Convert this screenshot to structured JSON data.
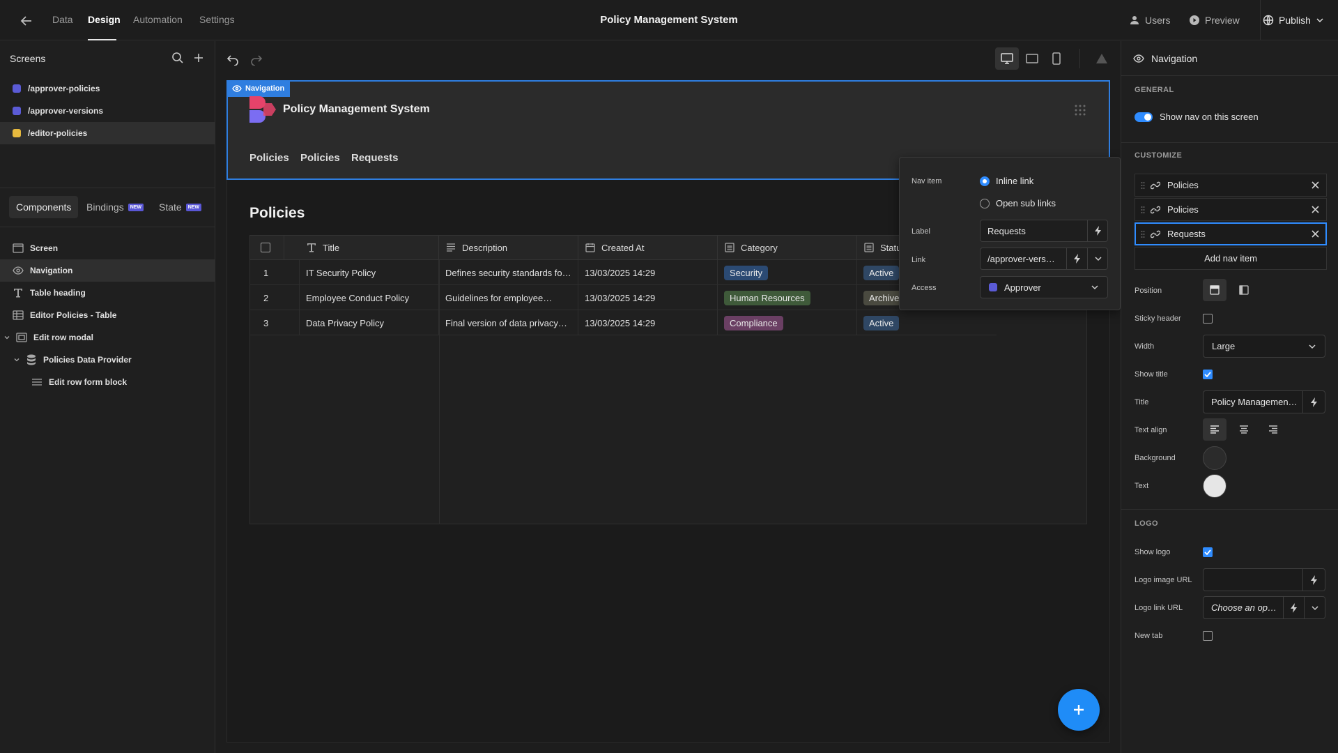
{
  "topbar": {
    "tabs": [
      {
        "label": "Data"
      },
      {
        "label": "Design"
      },
      {
        "label": "Automation"
      },
      {
        "label": "Settings"
      }
    ],
    "title": "Policy Management System",
    "users_label": "Users",
    "preview_label": "Preview",
    "publish_label": "Publish"
  },
  "left_panel": {
    "screens_title": "Screens",
    "screens": [
      {
        "route": "/approver-policies",
        "color": "#5b5bd6"
      },
      {
        "route": "/approver-versions",
        "color": "#5b5bd6"
      },
      {
        "route": "/editor-policies",
        "color": "#e6b93e"
      }
    ],
    "subtabs": [
      {
        "label": "Components",
        "badge": ""
      },
      {
        "label": "Bindings",
        "badge": "NEW"
      },
      {
        "label": "State",
        "badge": "NEW"
      }
    ],
    "components": [
      {
        "label": "Screen",
        "icon": "screen-icon"
      },
      {
        "label": "Navigation",
        "icon": "eye-icon"
      },
      {
        "label": "Table heading",
        "icon": "text-icon"
      },
      {
        "label": "Editor Policies - Table",
        "icon": "table-icon"
      },
      {
        "label": "Edit row modal",
        "icon": "modal-icon"
      },
      {
        "label": "Policies Data Provider",
        "icon": "database-icon"
      },
      {
        "label": "Edit row form block",
        "icon": "form-icon"
      }
    ]
  },
  "canvas": {
    "nav_badge": "Navigation",
    "site_title": "Policy Management System",
    "nav_links": [
      "Policies",
      "Policies",
      "Requests"
    ],
    "table_heading": "Policies",
    "table": {
      "columns": [
        "Title",
        "Description",
        "Created At",
        "Category",
        "Statu"
      ],
      "rows": [
        {
          "index": "1",
          "title": "IT Security Policy",
          "description": "Defines security standards fo…",
          "created": "13/03/2025 14:29",
          "category": "Security",
          "category_color": "#2b4a73",
          "status": "Active",
          "status_color": "#2f4764"
        },
        {
          "index": "2",
          "title": "Employee Conduct Policy",
          "description": "Guidelines for employee…",
          "created": "13/03/2025 14:29",
          "category": "Human Resources",
          "category_color": "#3f5a3a",
          "status": "Archive",
          "status_color": "#4a4a40"
        },
        {
          "index": "3",
          "title": "Data Privacy Policy",
          "description": "Final version of data privacy…",
          "created": "13/03/2025 14:29",
          "category": "Compliance",
          "category_color": "#6a3f63",
          "status": "Active",
          "status_color": "#2f4764"
        }
      ]
    }
  },
  "popover": {
    "nav_item_label": "Nav item",
    "option_inline": "Inline link",
    "option_sub": "Open sub links",
    "label_label": "Label",
    "label_value": "Requests",
    "link_label": "Link",
    "link_value": "/approver-vers…",
    "access_label": "Access",
    "access_value": "Approver",
    "access_color": "#5b5bd6"
  },
  "right_panel": {
    "title": "Navigation",
    "general_section": "GENERAL",
    "show_nav_label": "Show nav on this screen",
    "customize_section": "CUSTOMIZE",
    "nav_items": [
      "Policies",
      "Policies",
      "Requests"
    ],
    "add_nav_item": "Add nav item",
    "position_label": "Position",
    "sticky_label": "Sticky header",
    "width_label": "Width",
    "width_value": "Large",
    "show_title_label": "Show title",
    "title_label": "Title",
    "title_value": "Policy Managemen…",
    "text_align_label": "Text align",
    "background_label": "Background",
    "background_color": "#2b2b2b",
    "text_label": "Text",
    "text_color": "#e6e6e6",
    "logo_section": "LOGO",
    "show_logo_label": "Show logo",
    "logo_image_label": "Logo image URL",
    "logo_link_label": "Logo link URL",
    "logo_link_placeholder": "Choose an op…",
    "new_tab_label": "New tab"
  }
}
